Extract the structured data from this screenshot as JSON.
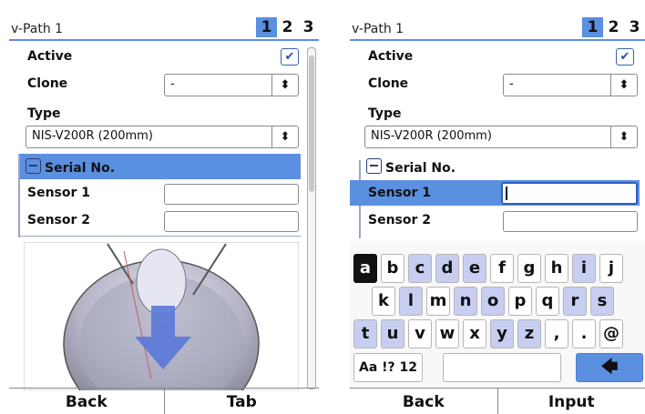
{
  "left": {
    "title": "v-Path 1",
    "tabs": [
      "1",
      "2",
      "3"
    ],
    "rows": {
      "active": "Active",
      "clone": "Clone",
      "clone_value": "-",
      "type": "Type",
      "type_value": "NIS-V200R (200mm)",
      "serial": "Serial No.",
      "sensor1": "Sensor 1",
      "sensor2": "Sensor 2"
    },
    "checkmark": "✔",
    "spinner": "⬍",
    "bottom": [
      "Back",
      "Tab"
    ]
  },
  "right": {
    "title": "v-Path 1",
    "tabs": [
      "1",
      "2",
      "3"
    ],
    "rows": {
      "active": "Active",
      "clone": "Clone",
      "clone_value": "-",
      "type": "Type",
      "type_value": "NIS-V200R (200mm)",
      "serial": "Serial No.",
      "sensor1": "Sensor 1",
      "sensor2": "Sensor 2"
    },
    "checkmark": "✔",
    "spinner": "⬍",
    "keyboard": {
      "row1": [
        "a",
        "b",
        "c",
        "d",
        "e",
        "f",
        "g",
        "h",
        "i",
        "j"
      ],
      "row2": [
        "k",
        "l",
        "m",
        "n",
        "o",
        "p",
        "q",
        "r",
        "s"
      ],
      "row3": [
        "t",
        "u",
        "v",
        "w",
        "x",
        "y",
        "z",
        ",",
        ".",
        "@"
      ],
      "mode": "Aa !? 12",
      "backspace": "🡄"
    },
    "bottom": [
      "Back",
      "Input"
    ]
  },
  "colors": {
    "accent": "#5b8fe0",
    "key_highlight": "#c8cef2"
  }
}
